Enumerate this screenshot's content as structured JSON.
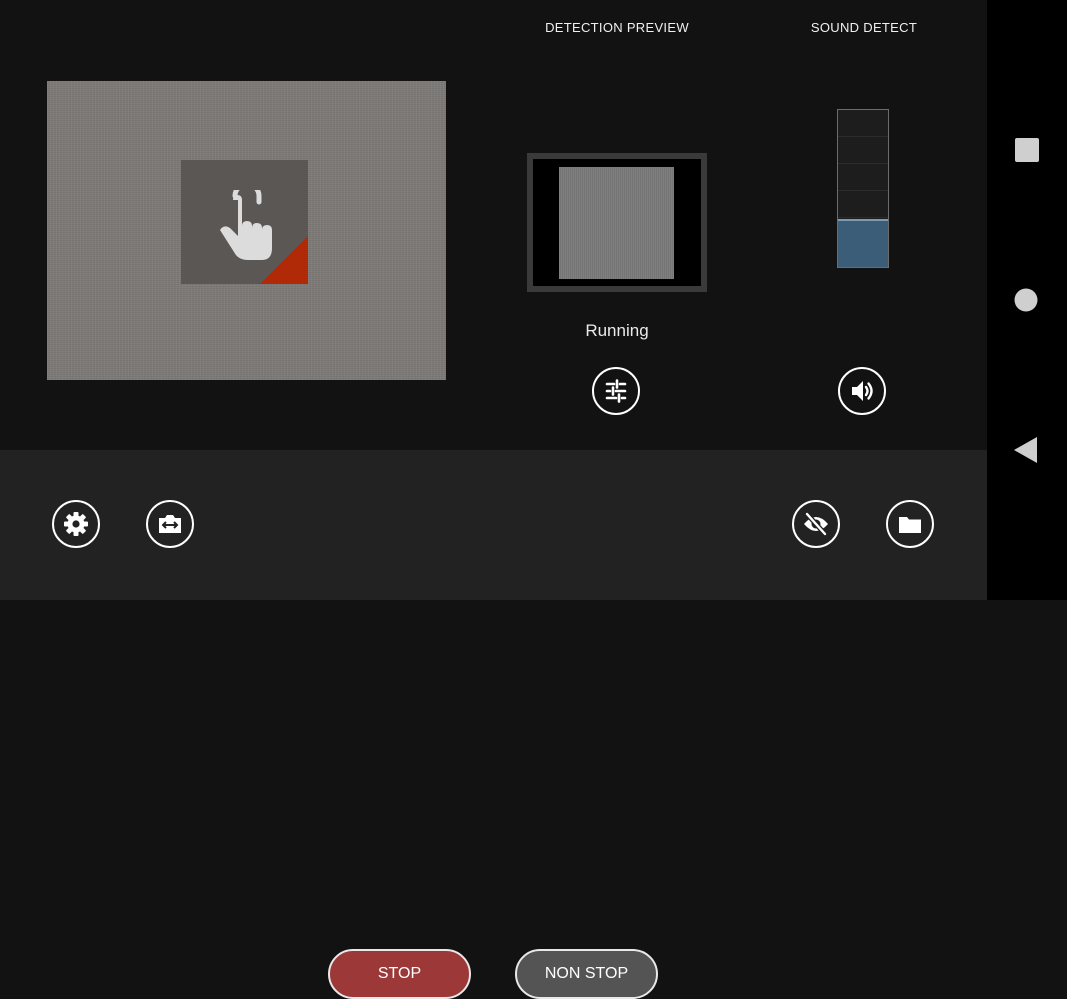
{
  "detection_preview": {
    "title": "DETECTION PREVIEW",
    "status": "Running"
  },
  "sound_detect": {
    "title": "SOUND DETECT",
    "level": 0.29
  },
  "controls": {
    "stop_label": "STOP",
    "nonstop_label": "NON STOP"
  },
  "icons": {
    "camera_tap": "touch-hand-icon",
    "filter": "sliders-icon",
    "sound": "speaker-icon",
    "settings": "gear-icon",
    "switch_camera": "switch-camera-icon",
    "hide": "eye-off-icon",
    "folder": "folder-icon",
    "nav_recents": "square-icon",
    "nav_home": "circle-icon",
    "nav_back": "triangle-back-icon"
  },
  "colors": {
    "stop": "#9c3838",
    "nonstop": "#545454",
    "meter_fill": "#3c5d78",
    "accent_corner": "#b02a08"
  }
}
